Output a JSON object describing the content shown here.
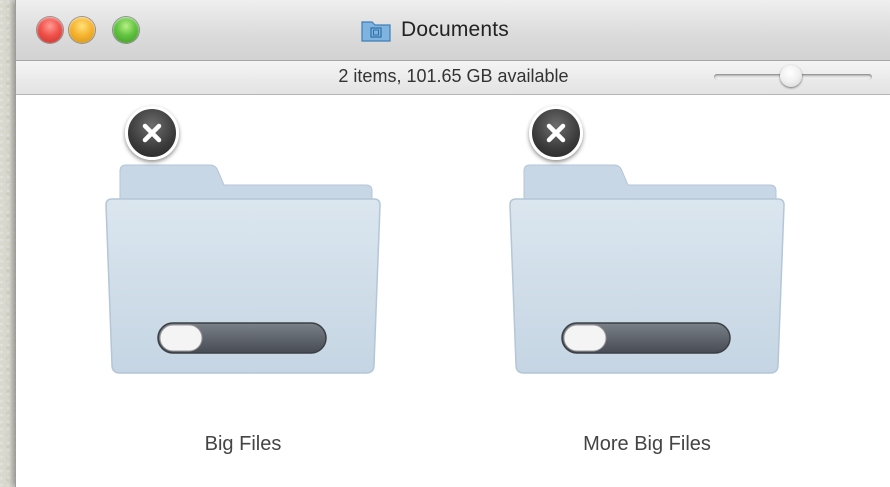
{
  "window": {
    "title": "Documents",
    "title_icon": "folder-icon",
    "status": "2 items, 101.65 GB available",
    "controls": [
      "close-button",
      "minimize-button",
      "zoom-button"
    ],
    "icon_size_slider": {
      "value": 0.52
    }
  },
  "items": [
    {
      "label": "Big Files",
      "icon": "folder-icon",
      "delete_icon": "close-x-icon",
      "toggle_icon": "toggle-switch-icon"
    },
    {
      "label": "More Big Files",
      "icon": "folder-icon",
      "delete_icon": "close-x-icon",
      "toggle_icon": "toggle-switch-icon"
    }
  ],
  "colors": {
    "folder_body": "#cfdce8",
    "folder_shade": "#b9c9d8",
    "toggle_track": "#5b6068",
    "delete_badge": "#3a3a3a"
  }
}
